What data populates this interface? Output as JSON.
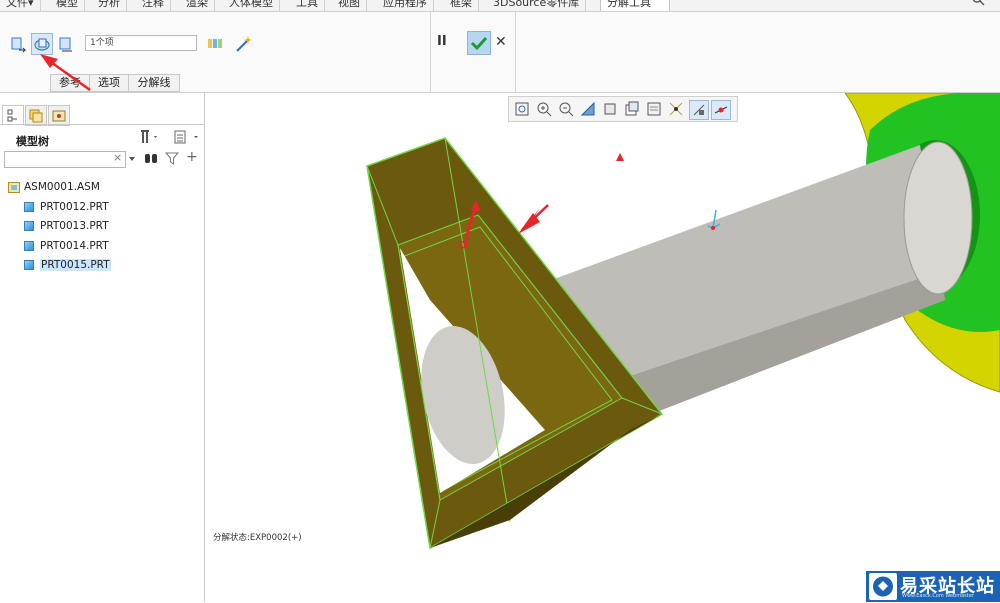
{
  "menubar": {
    "tabs": [
      "文件▾",
      "模型",
      "分析",
      "注释",
      "渲染",
      "人体模型",
      "工具",
      "视图",
      "应用程序",
      "框架",
      "3DSource零件库",
      "分解工具"
    ],
    "active_tab": "分解工具"
  },
  "ribbon": {
    "selection_combo": "1个项",
    "subtabs": [
      "参考",
      "选项",
      "分解线"
    ],
    "pause_label": "II",
    "confirm_icon": "check-icon",
    "cancel_label": "✕"
  },
  "model_tree": {
    "title": "模型树",
    "search_placeholder": "",
    "root": "ASM0001.ASM",
    "parts": [
      "PRT0012.PRT",
      "PRT0013.PRT",
      "PRT0014.PRT",
      "PRT0015.PRT"
    ],
    "selected_part": "PRT0015.PRT"
  },
  "viewport": {
    "status_text": "分解状态:EXP0002(+)"
  },
  "watermark": {
    "text": "易采站长站",
    "subtext": "Www.Easck.Com Webmaster"
  },
  "colors": {
    "part_fill": "#6b5a0e",
    "part_edge": "#6fd64a",
    "cylinder": "#bfbdb7",
    "green_ring": "#22c222",
    "yellow_disc": "#d8d800",
    "annotation_red": "#e8252a",
    "confirm_blue": "#b7d6f2"
  }
}
